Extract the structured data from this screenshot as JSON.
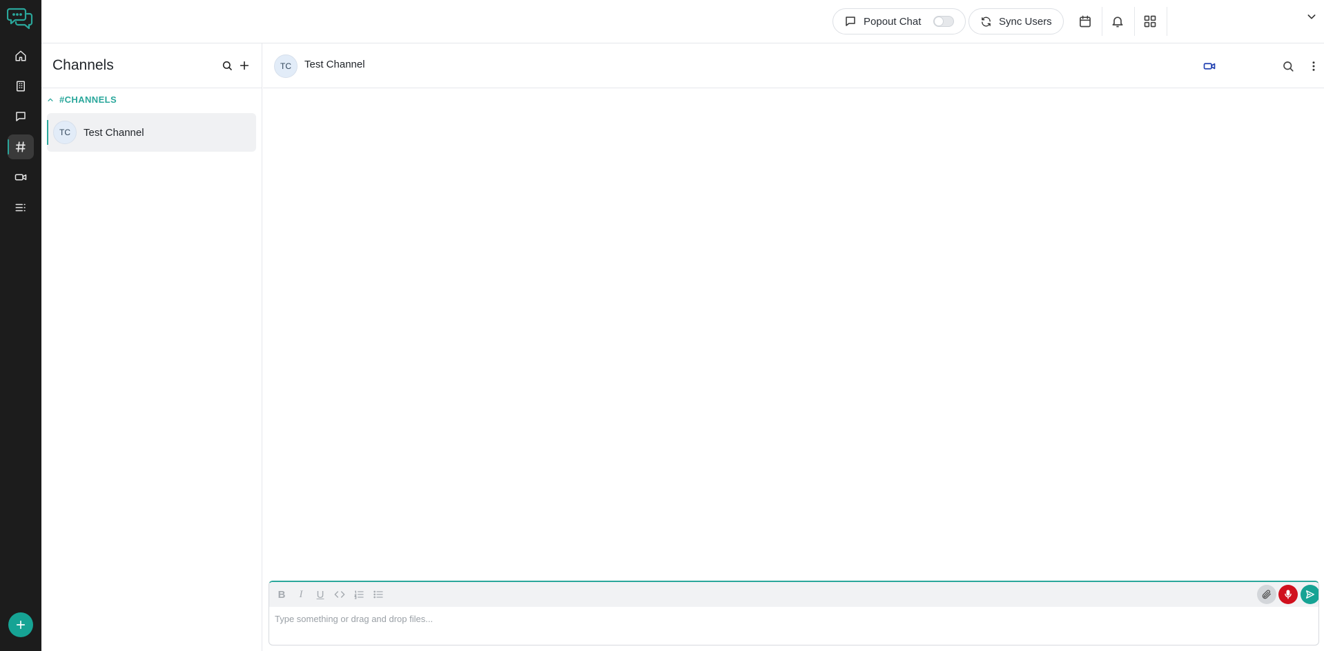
{
  "colors": {
    "accent": "#2aa79b",
    "rail_bg": "#1c1c1c",
    "record": "#d0101d",
    "send": "#16a394"
  },
  "rail": {
    "logo_icon": "chat-bubbles-logo-icon",
    "items": [
      {
        "name": "home-icon",
        "active": false
      },
      {
        "name": "building-icon",
        "active": false
      },
      {
        "name": "message-icon",
        "active": false
      },
      {
        "name": "hash-icon",
        "active": true
      },
      {
        "name": "video-icon",
        "active": false
      },
      {
        "name": "list-icon",
        "active": false
      }
    ],
    "fab_icon": "plus-icon"
  },
  "topbar": {
    "popout_label": "Popout Chat",
    "popout_enabled": false,
    "sync_label": "Sync Users",
    "icons": [
      "calendar-icon",
      "bell-icon",
      "apps-grid-icon",
      "chevron-down-icon"
    ]
  },
  "channels": {
    "title": "Channels",
    "section_label": "#CHANNELS",
    "items": [
      {
        "initials": "TC",
        "name": "Test Channel",
        "selected": true
      }
    ]
  },
  "chat": {
    "initials": "TC",
    "title": "Test Channel",
    "icons": [
      "video-call-icon",
      "search-icon",
      "more-vertical-icon"
    ]
  },
  "composer": {
    "placeholder": "Type something or drag and drop files...",
    "format_tools": [
      "bold",
      "italic",
      "underline",
      "code",
      "ordered-list",
      "bullet-list"
    ]
  }
}
